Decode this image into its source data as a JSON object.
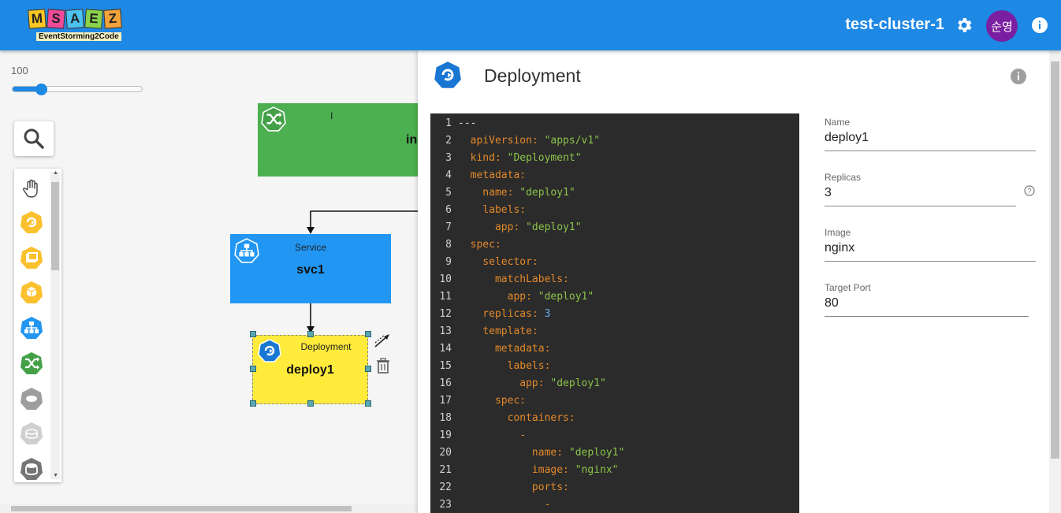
{
  "app": {
    "logo_letters": [
      "M",
      "S",
      "A",
      "E",
      "Z"
    ],
    "logo_colors": [
      "#f9c623",
      "#f04a9a",
      "#4cc2f1",
      "#8bd34a",
      "#f4a33a"
    ],
    "logo_subtitle": "EventStorming2Code",
    "cluster_name": "test-cluster-1",
    "user_initials": "순영",
    "accent": "#1e88e5"
  },
  "canvas": {
    "zoom_value": "100",
    "zoom_fraction": 0.22,
    "palette_items": [
      "hand-icon",
      "deployment-icon",
      "replicaset-icon",
      "pod-icon",
      "service-icon",
      "ingress-icon",
      "volume-icon",
      "persistent-volume-icon",
      "storage-icon"
    ],
    "nodes": {
      "ingress": {
        "type": "I",
        "name": "in",
        "color": "#4caf50"
      },
      "service": {
        "type": "Service",
        "name": "svc1",
        "color": "#2196f3"
      },
      "deployment": {
        "type": "Deployment",
        "name": "deploy1",
        "color": "#ffeb3b"
      }
    }
  },
  "panel": {
    "title": "Deployment",
    "code_lines": [
      [
        [
          "p",
          "---"
        ]
      ],
      [
        [
          "k",
          "  apiVersion: "
        ],
        [
          "s",
          "\"apps/v1\""
        ]
      ],
      [
        [
          "k",
          "  kind: "
        ],
        [
          "s",
          "\"Deployment\""
        ]
      ],
      [
        [
          "k",
          "  metadata:"
        ]
      ],
      [
        [
          "k",
          "    name: "
        ],
        [
          "s",
          "\"deploy1\""
        ]
      ],
      [
        [
          "k",
          "    labels:"
        ]
      ],
      [
        [
          "k",
          "      app: "
        ],
        [
          "s",
          "\"deploy1\""
        ]
      ],
      [
        [
          "k",
          "  spec:"
        ]
      ],
      [
        [
          "k",
          "    selector:"
        ]
      ],
      [
        [
          "k",
          "      matchLabels:"
        ]
      ],
      [
        [
          "k",
          "        app: "
        ],
        [
          "s",
          "\"deploy1\""
        ]
      ],
      [
        [
          "k",
          "    replicas: "
        ],
        [
          "n",
          "3"
        ]
      ],
      [
        [
          "k",
          "    template:"
        ]
      ],
      [
        [
          "k",
          "      metadata:"
        ]
      ],
      [
        [
          "k",
          "        labels:"
        ]
      ],
      [
        [
          "k",
          "          app: "
        ],
        [
          "s",
          "\"deploy1\""
        ]
      ],
      [
        [
          "k",
          "      spec:"
        ]
      ],
      [
        [
          "k",
          "        containers:"
        ]
      ],
      [
        [
          "k",
          "          -"
        ]
      ],
      [
        [
          "k",
          "            name: "
        ],
        [
          "s",
          "\"deploy1\""
        ]
      ],
      [
        [
          "k",
          "            image: "
        ],
        [
          "s",
          "\"nginx\""
        ]
      ],
      [
        [
          "k",
          "            ports:"
        ]
      ],
      [
        [
          "k",
          "              -"
        ]
      ]
    ],
    "fields": [
      {
        "label": "Name",
        "value": "deploy1"
      },
      {
        "label": "Replicas",
        "value": "3"
      },
      {
        "label": "Image",
        "value": "nginx"
      },
      {
        "label": "Target Port",
        "value": "80"
      }
    ]
  }
}
